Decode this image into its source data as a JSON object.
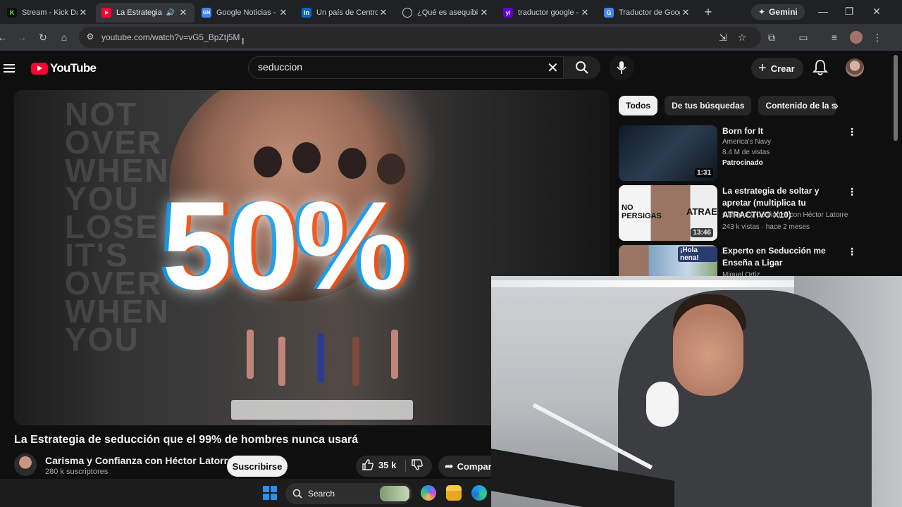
{
  "browser": {
    "tabs": [
      {
        "title": "Stream - Kick Dash",
        "favicon_color": "#53fc18",
        "favicon_letter": "K",
        "active": false
      },
      {
        "title": "La Estrategia d",
        "favicon_color": "#ff0033",
        "favicon_letter": "",
        "active": true
      },
      {
        "title": "Google Noticias - ",
        "favicon_color": "#4285f4",
        "favicon_letter": "GN",
        "active": false
      },
      {
        "title": "Un país de Centro",
        "favicon_color": "#0a66c2",
        "favicon_letter": "in",
        "active": false
      },
      {
        "title": "¿Qué es asequibili",
        "favicon_color": "#5f6368",
        "favicon_letter": "",
        "active": false
      },
      {
        "title": "traductor google -",
        "favicon_color": "#6001d2",
        "favicon_letter": "y/",
        "active": false
      },
      {
        "title": "Traductor de Goog",
        "favicon_color": "#4285f4",
        "favicon_letter": "G",
        "active": false
      }
    ],
    "gemini_label": "Gemini",
    "url": "youtube.com/watch?v=vG5_BpZtj5M"
  },
  "youtube": {
    "logo_text": "YouTube",
    "search_value": "seduccion",
    "create_label": "Crear",
    "video": {
      "overlay_text": "50%",
      "wall_text": "NOT OVER WHEN YOU LOSE IT'S OVER WHEN YOU",
      "title": "La Estrategia de seducción que el 99% de hombres nunca usará",
      "channel": "Carisma y Confianza con Héctor Latorre",
      "subscribers": "280 k suscriptores",
      "subscribe_label": "Suscribirse",
      "likes": "35 k",
      "share_label": "Compartir"
    },
    "chips": [
      "Todos",
      "De tus búsquedas",
      "Contenido de la serie"
    ],
    "recommendations": [
      {
        "title": "Born for It",
        "channel": "America's Navy",
        "meta": "8.4 M de vistas",
        "badge": "Patrocinado",
        "duration": "1:31",
        "thumb_color": "#1d2a3a"
      },
      {
        "title": "La estrategia de soltar y apretar (multiplica tu ATRACTIVO X10)",
        "channel": "Carisma y Confianza con Héctor Latorre",
        "meta": "243 k vistas · hace 2 meses",
        "badge": "",
        "duration": "13:46",
        "thumb_color": "#ffffff",
        "thumb_text_left": "NO PERSIGAS",
        "thumb_text_right": "ATRAE"
      },
      {
        "title": "Experto en Seducción me Enseña a Ligar",
        "channel": "Miguel Ortiz",
        "meta": "",
        "badge": "",
        "duration": "",
        "thumb_color": "#6b8fb8",
        "thumb_text_right": "¡Hola nena!"
      }
    ]
  },
  "taskbar": {
    "search_label": "Search"
  }
}
